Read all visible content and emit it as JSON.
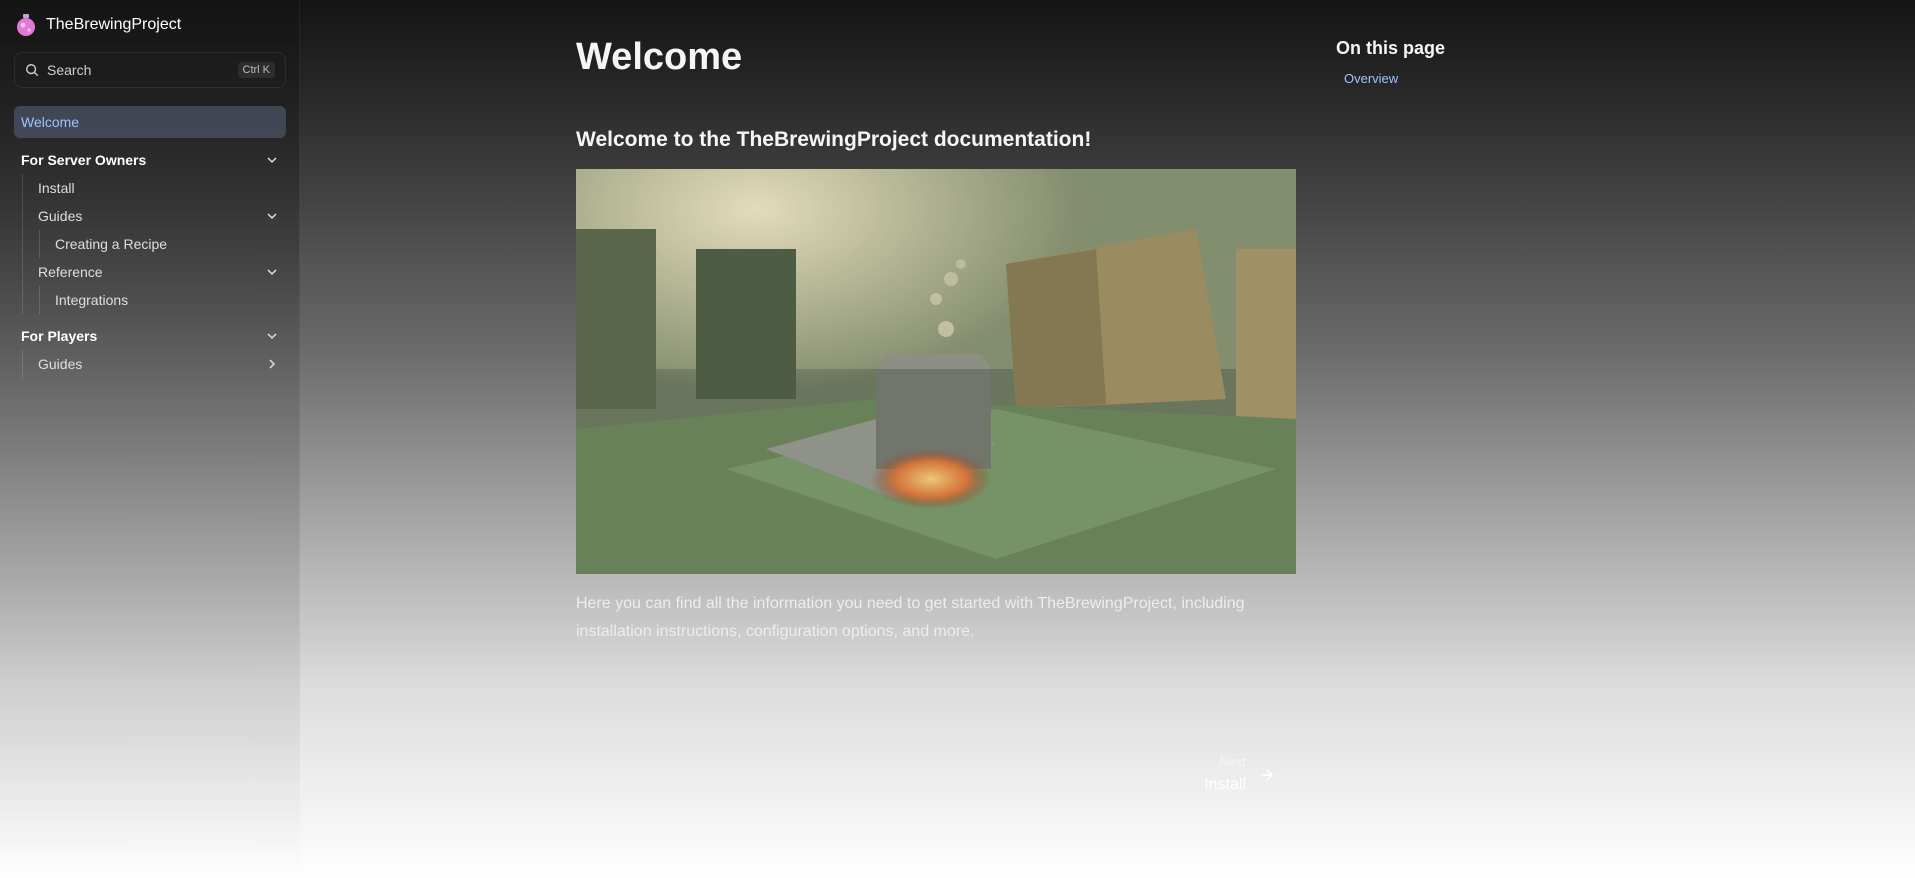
{
  "brand": {
    "name": "TheBrewingProject"
  },
  "search": {
    "label": "Search",
    "shortcut": "Ctrl K"
  },
  "sidebar": {
    "welcome": "Welcome",
    "server_owners": {
      "label": "For Server Owners",
      "install": "Install",
      "guides": "Guides",
      "creating_recipe": "Creating a Recipe",
      "reference": "Reference",
      "integrations": "Integrations"
    },
    "players": {
      "label": "For Players",
      "guides": "Guides"
    }
  },
  "main": {
    "title": "Welcome",
    "heading": "Welcome to the TheBrewingProject documentation!",
    "body": "Here you can find all the information you need to get started with TheBrewingProject, including installation instructions, configuration options, and more."
  },
  "pager": {
    "next_label": "Next",
    "next_title": "Install"
  },
  "toc": {
    "title": "On this page",
    "items": [
      "Overview"
    ]
  },
  "colors": {
    "accent": "#9ec3ff",
    "active_bg": "#4b5366",
    "logo": "#e07ad6"
  }
}
